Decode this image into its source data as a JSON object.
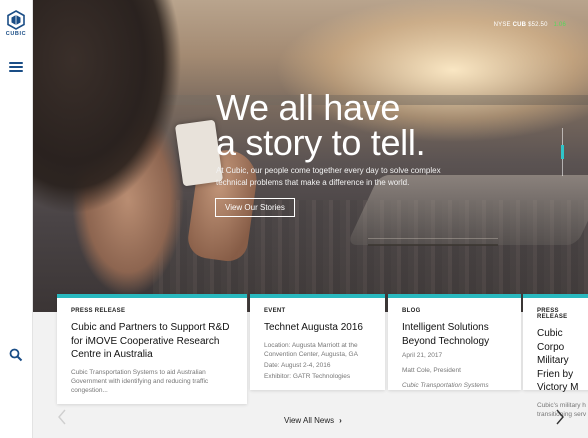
{
  "brand": {
    "name": "CUBIC"
  },
  "stock": {
    "exchange": "NYSE",
    "ticker": "CUB",
    "price": "$52.50",
    "change": "1.06"
  },
  "hero": {
    "headline_line1": "We all have",
    "headline_line2": "a story to tell.",
    "subtext": "At Cubic, our people come together every day to solve complex technical problems that make a difference in the world.",
    "cta_label": "View Our Stories"
  },
  "cards": [
    {
      "category": "PRESS RELEASE",
      "title": "Cubic and Partners to Support R&D for iMOVE Cooperative Research Centre in Australia",
      "body": "Cubic Transportation Systems to aid Australian Government with identifying and reducing traffic congestion..."
    },
    {
      "category": "EVENT",
      "title": "Technet Augusta 2016",
      "location": "Location: Augusta Marriott at the Convention Center, Augusta, GA",
      "date": "Date: August 2-4, 2016",
      "exhibitor": "Exhibitor: GATR Technologies"
    },
    {
      "category": "BLOG",
      "title": "Intelligent Solutions Beyond Technology",
      "date": "April 21, 2017",
      "author": "Matt Cole, President",
      "org": "Cubic Transportation Systems"
    },
    {
      "category": "PRESS RELEASE",
      "title": "Cubic Corpo Military Frien by Victory M",
      "body": "Cubic's military h transitioning serv"
    }
  ],
  "news": {
    "view_all_label": "View All News",
    "chevron": "›"
  },
  "colors": {
    "accent": "#29b9bf",
    "brand_blue": "#1a4d86",
    "stock_up": "#54d85a"
  },
  "icons": [
    "cubic-logo-icon",
    "menu-icon",
    "search-icon",
    "chevron-left-icon",
    "chevron-right-icon"
  ]
}
